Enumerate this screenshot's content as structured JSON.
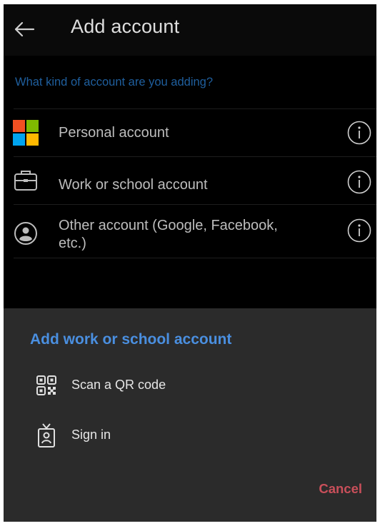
{
  "appbar": {
    "title": "Add account",
    "back_icon": "arrow-left-icon"
  },
  "question": "What kind of account are you adding?",
  "accounts": [
    {
      "label": "Personal account",
      "icon": "microsoft-logo-icon",
      "info_icon": "info-icon"
    },
    {
      "label": "Work or school account",
      "icon": "briefcase-icon",
      "info_icon": "info-icon"
    },
    {
      "label_line1": "Other account (Google, Facebook,",
      "label_line2": "etc.)",
      "icon": "person-circle-icon",
      "info_icon": "info-icon"
    }
  ],
  "sheet": {
    "title": "Add work or school account",
    "items": [
      {
        "label": "Scan a QR code",
        "icon": "qr-code-icon"
      },
      {
        "label": "Sign in",
        "icon": "id-badge-icon"
      }
    ],
    "cancel_label": "Cancel"
  },
  "colors": {
    "background": "#000000",
    "appbar": "#0a0a0a",
    "sheet": "#2b2b2b",
    "accent_blue": "#4a8fe0",
    "question_blue": "#1f5f9e",
    "cancel_red": "#c94f5a",
    "ms_red": "#f25022",
    "ms_green": "#7fba00",
    "ms_blue": "#00a4ef",
    "ms_yellow": "#ffb900"
  }
}
